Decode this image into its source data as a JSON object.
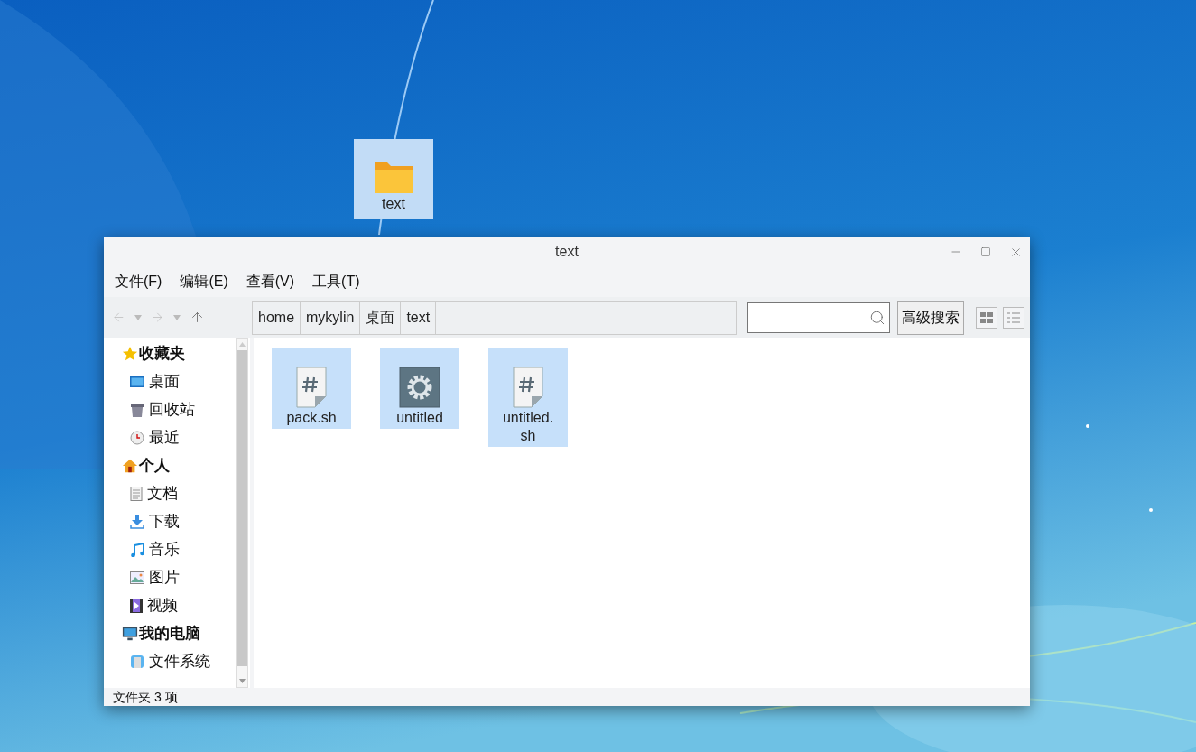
{
  "desktop": {
    "icons": [
      {
        "label": "text",
        "selected": true
      }
    ]
  },
  "window": {
    "title": "text",
    "menu": [
      "文件(F)",
      "编辑(E)",
      "查看(V)",
      "工具(T)"
    ],
    "breadcrumb": [
      {
        "label": "home"
      },
      {
        "label": "mykylin"
      },
      {
        "label": "桌面"
      },
      {
        "label": "text"
      }
    ],
    "advanced_search": "高级搜索",
    "view_modes": [
      {
        "kind": "icons",
        "selected": false
      },
      {
        "kind": "list",
        "selected": false
      }
    ],
    "sidebar": [
      {
        "label": "收藏夹",
        "kind": "favorites",
        "children": [
          {
            "label": "桌面",
            "kind": "desktop"
          },
          {
            "label": "回收站",
            "kind": "trash"
          },
          {
            "label": "最近",
            "kind": "recent"
          }
        ]
      },
      {
        "label": "个人",
        "kind": "home",
        "children": [
          {
            "label": "文档",
            "kind": "documents"
          },
          {
            "label": "下载",
            "kind": "downloads"
          },
          {
            "label": "音乐",
            "kind": "music"
          },
          {
            "label": "图片",
            "kind": "pictures"
          },
          {
            "label": "视频",
            "kind": "videos"
          }
        ]
      },
      {
        "label": "我的电脑",
        "kind": "computer",
        "children": [
          {
            "label": "文件系统",
            "kind": "filesystem"
          }
        ]
      }
    ],
    "files": [
      {
        "name": "pack.sh",
        "kind": "script",
        "selected": true
      },
      {
        "name": "untitled",
        "kind": "executable",
        "selected": true
      },
      {
        "name": "untitled.sh",
        "kind": "script",
        "selected": true
      }
    ],
    "status": "文件夹 3 项"
  }
}
